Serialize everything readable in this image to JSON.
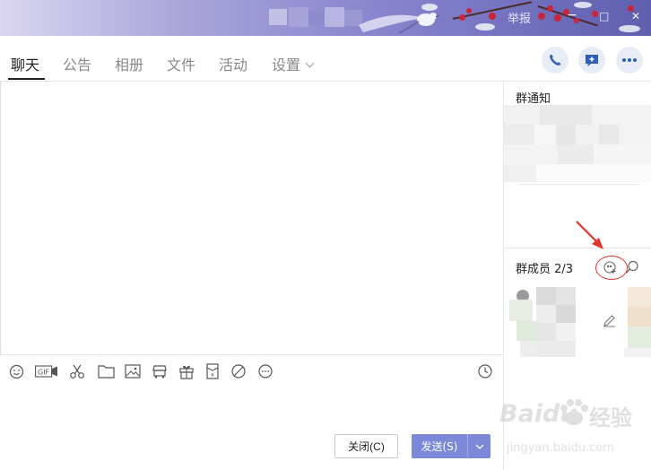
{
  "banner": {
    "window_text": "举报",
    "controls": {
      "minimize": "−",
      "maximize": "□",
      "close": "✕"
    }
  },
  "tabs": [
    {
      "label": "聊天",
      "active": true
    },
    {
      "label": "公告",
      "active": false
    },
    {
      "label": "相册",
      "active": false
    },
    {
      "label": "文件",
      "active": false
    },
    {
      "label": "活动",
      "active": false
    },
    {
      "label": "设置",
      "active": false,
      "has_dropdown": true
    }
  ],
  "header_actions": [
    "phone-icon",
    "add-chat-icon",
    "more-icon"
  ],
  "toolbar": {
    "gif_label": "GIF",
    "tools": [
      "emoji-icon",
      "gif-icon",
      "scissors-icon",
      "folder-icon",
      "image-icon",
      "shop-icon",
      "gift-icon",
      "red-packet-icon",
      "block-icon",
      "more-circle-icon"
    ],
    "history_icon": "clock-icon"
  },
  "buttons": {
    "close_label": "关闭(C)",
    "send_label": "发送(S)"
  },
  "side": {
    "notice_title": "群通知",
    "members_title": "群成员 2/3",
    "members_icons": [
      "add-member-icon",
      "search-icon",
      "edit-icon"
    ]
  },
  "watermark": {
    "brand": "Baidu",
    "sub": "经验",
    "url": "jingyan.baidu.com"
  },
  "colors": {
    "accent": "#7c89d8",
    "annotation_red": "#e0342c",
    "tab_active": "#222222",
    "tab_inactive": "#888888"
  }
}
